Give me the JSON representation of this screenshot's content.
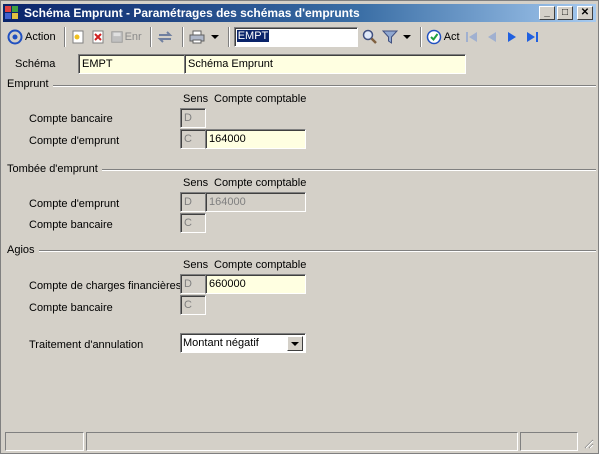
{
  "window": {
    "title": "Schéma Emprunt - Paramétrages des schémas d'emprunts",
    "minimize": "_",
    "maximize": "□",
    "close": "✕"
  },
  "toolbar": {
    "action_label": "Action",
    "save_label": "Enr",
    "search_value": "EMPT",
    "act_label": "Act"
  },
  "schema": {
    "label": "Schéma",
    "code": "EMPT",
    "name": "Schéma Emprunt"
  },
  "column_headers": {
    "sens": "Sens",
    "compte": "Compte comptable"
  },
  "emprunt": {
    "title": "Emprunt",
    "rows": [
      {
        "label": "Compte bancaire",
        "sens": "D",
        "compte": ""
      },
      {
        "label": "Compte d'emprunt",
        "sens": "C",
        "compte": "164000"
      }
    ]
  },
  "tombee": {
    "title": "Tombée d'emprunt",
    "rows": [
      {
        "label": "Compte d'emprunt",
        "sens": "D",
        "compte": "164000"
      },
      {
        "label": "Compte bancaire",
        "sens": "C",
        "compte": ""
      }
    ]
  },
  "agios": {
    "title": "Agios",
    "rows": [
      {
        "label": "Compte de charges financières",
        "sens": "D",
        "compte": "660000"
      },
      {
        "label": "Compte bancaire",
        "sens": "C",
        "compte": ""
      }
    ],
    "annulation_label": "Traitement d'annulation",
    "annulation_value": "Montant négatif"
  },
  "colors": {
    "title_start": "#0a246a",
    "title_end": "#a6caf0",
    "field_yellow": "#ffffe1",
    "window_bg": "#d4d0c8"
  }
}
